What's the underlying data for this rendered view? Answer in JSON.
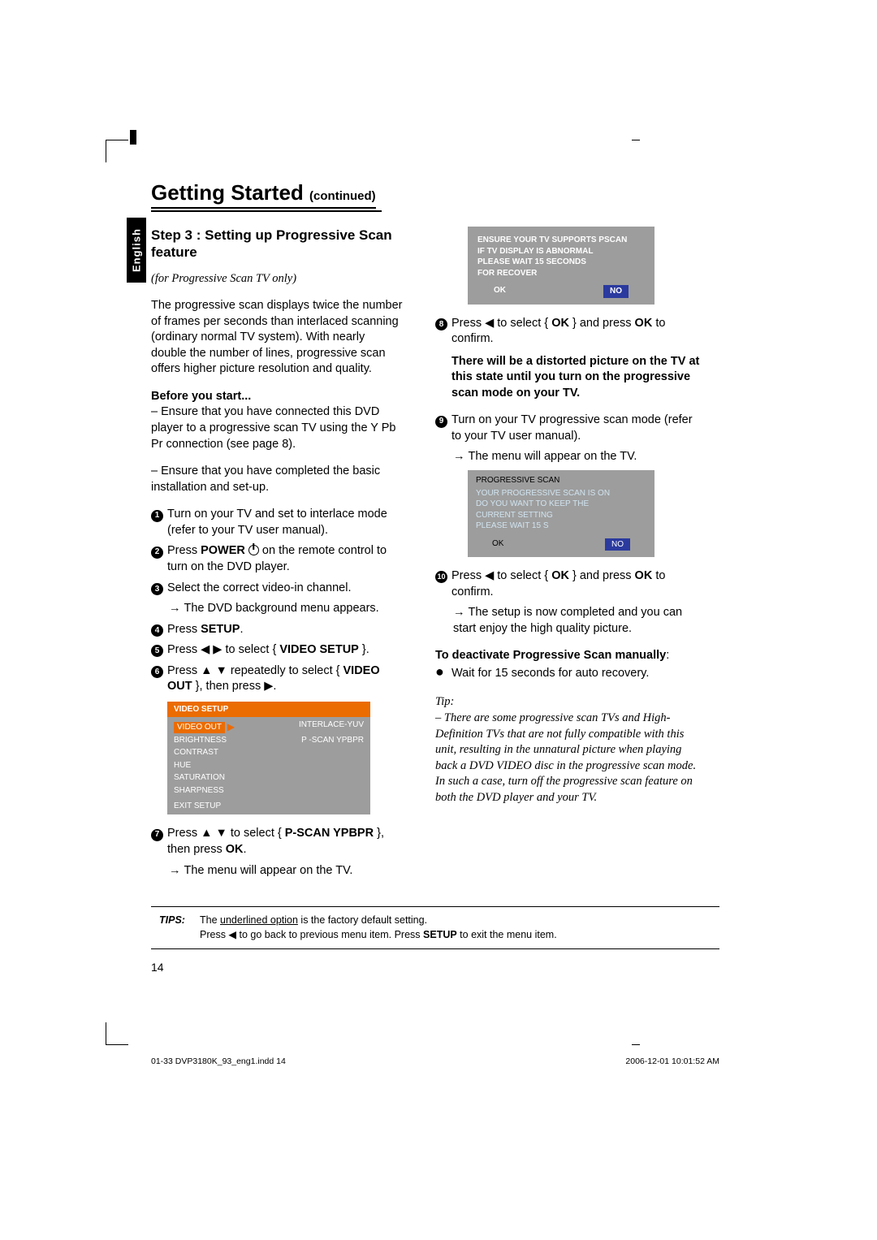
{
  "header": {
    "title": "Getting Started",
    "continued": "(continued)"
  },
  "language_tab": "English",
  "left": {
    "section_title": "Step 3 : Setting up Progressive Scan feature",
    "subtitle_italic": "(for Progressive Scan TV only)",
    "intro": "The progressive scan displays twice the number of frames per seconds than interlaced scanning (ordinary normal TV system). With nearly double the number of lines, progressive scan offers higher picture resolution and quality.",
    "before_label": "Before you start...",
    "before_1": "– Ensure that you have connected this DVD player to a progressive scan TV using the Y Pb Pr connection (see page 8).",
    "before_2": "– Ensure that you have completed the basic installation and set-up.",
    "s1": "Turn on your TV and set to interlace mode (refer to your TV user manual).",
    "s2a": "Press ",
    "s2b": "POWER",
    "s2c": " on the remote control to turn on the DVD player.",
    "s3": "Select the correct video-in channel.",
    "s3_sub": "The DVD background menu appears.",
    "s4a": "Press ",
    "s4b": "SETUP",
    "s4c": ".",
    "s5a": "Press ◀ ▶ to select { ",
    "s5b": "VIDEO SETUP",
    "s5c": " }.",
    "s6a": "Press ▲ ▼ repeatedly to select { ",
    "s6b": "VIDEO OUT",
    "s6c": " }, then press ▶.",
    "s7a": "Press ▲ ▼ to select { ",
    "s7b": "P-SCAN YPBPR",
    "s7c": " }, then press ",
    "s7d": "OK",
    "s7e": ".",
    "s7_sub": "The menu will appear on the TV."
  },
  "video_menu": {
    "header": "VIDEO  SETUP",
    "rows": [
      {
        "left": "VIDEO OUT",
        "right": "INTERLACE-YUV",
        "sel": true
      },
      {
        "left": "BRIGHTNESS",
        "right": "P -SCAN YPBPR"
      },
      {
        "left": "CONTRAST",
        "right": ""
      },
      {
        "left": "HUE",
        "right": ""
      },
      {
        "left": "SATURATION",
        "right": ""
      },
      {
        "left": "SHARPNESS",
        "right": ""
      }
    ],
    "exit": "EXIT SETUP"
  },
  "right": {
    "dialog1": {
      "l1": "ENSURE YOUR TV SUPPORTS PSCAN",
      "l2": "IF TV DISPLAY IS ABNORMAL",
      "l3": "PLEASE WAIT 15 SECONDS",
      "l4": "FOR  RECOVER",
      "ok": "OK",
      "no": "NO"
    },
    "s8a": "Press ◀ to select { ",
    "s8b": "OK",
    "s8c": " } and press ",
    "s8d": "OK",
    "s8e": " to confirm.",
    "warn": "There will be a distorted picture on the TV at this state until you turn on the progressive scan mode on your TV.",
    "s9": "Turn on your TV progressive scan mode (refer to your TV user manual).",
    "s9_sub": "The menu will appear on the TV.",
    "dialog2": {
      "hd": "PROGRESSIVE SCAN",
      "l1": "YOUR PROGRESSIVE SCAN IS ON",
      "l2": "DO YOU WANT TO KEEP THE",
      "l3": "CURRENT SETTING",
      "l4": "PLEASE WAIT 15 S",
      "ok": "OK",
      "no": "NO"
    },
    "s10a": "Press ◀ to select { ",
    "s10b": "OK",
    "s10c": " } and press ",
    "s10d": "OK",
    "s10e": " to confirm.",
    "s10_sub": "The setup is now completed and you can start enjoy the high quality picture.",
    "deact_label": "To deactivate Progressive Scan manually",
    "deact_colon": ":",
    "deact_item": "Wait for 15 seconds for auto recovery.",
    "tip_label": "Tip:",
    "tip_body": "– There are some progressive scan TVs and High-Definition TVs that are not fully compatible with this unit, resulting in the unnatural picture when playing back a DVD VIDEO disc in the progressive scan mode. In such a case, turn off the progressive scan feature on both the DVD player and your TV."
  },
  "tips": {
    "label": "TIPS:",
    "line1a": "The ",
    "line1b": "underlined option",
    "line1c": " is the factory default setting.",
    "line2a": "Press ◀ to go back to previous menu item. Press ",
    "line2b": "SETUP",
    "line2c": " to exit the menu item."
  },
  "page_number": "14",
  "footer": {
    "left": "01-33 DVP3180K_93_eng1.indd   14",
    "right": "2006-12-01   10:01:52 AM"
  }
}
